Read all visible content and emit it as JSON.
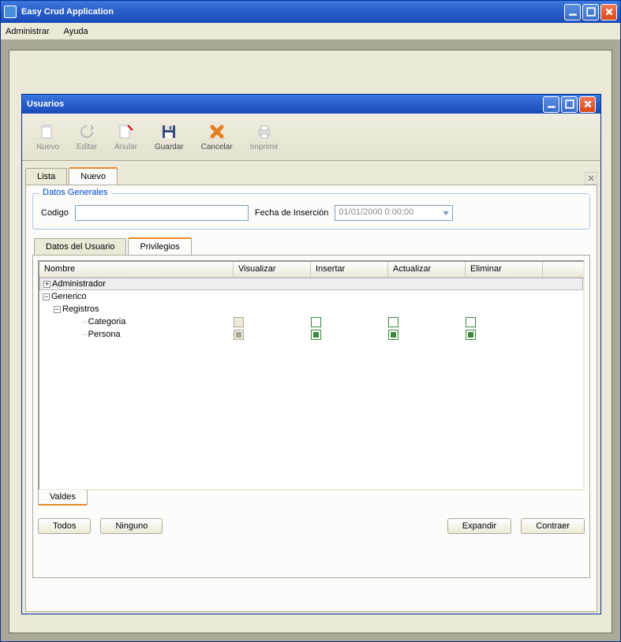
{
  "app": {
    "title": "Easy Crud Application"
  },
  "menubar": {
    "administrar": "Administrar",
    "ayuda": "Ayuda"
  },
  "dialog": {
    "title": "Usuarios"
  },
  "toolbar": {
    "nuevo": "Nuevo",
    "editar": "Editar",
    "anular": "Anular",
    "guardar": "Guardar",
    "cancelar": "Cancelar",
    "imprimir": "Imprimir"
  },
  "tabs": {
    "lista": "Lista",
    "nuevo": "Nuevo",
    "active": "Nuevo"
  },
  "general": {
    "legend": "Datos Generales",
    "codigo_label": "Codigo",
    "codigo_value": "",
    "fecha_label": "Fecha de Inserción",
    "fecha_value": "01/01/2000 0:00:00"
  },
  "inner_tabs": {
    "datos": "Datos del Usuario",
    "priv": "Privilegios",
    "active": "Privilegios"
  },
  "grid": {
    "columns": {
      "nombre": "Nombre",
      "visualizar": "Visualizar",
      "insertar": "Insertar",
      "actualizar": "Actualizar",
      "eliminar": "Eliminar"
    },
    "rows": {
      "admin": "Administrador",
      "generico": "Generico",
      "registros": "Registros",
      "categoria": "Categoria",
      "persona": "Persona"
    }
  },
  "footer_tab": "Valdes",
  "buttons": {
    "todos": "Todos",
    "ninguno": "Ninguno",
    "expandir": "Expandir",
    "contraer": "Contraer"
  }
}
